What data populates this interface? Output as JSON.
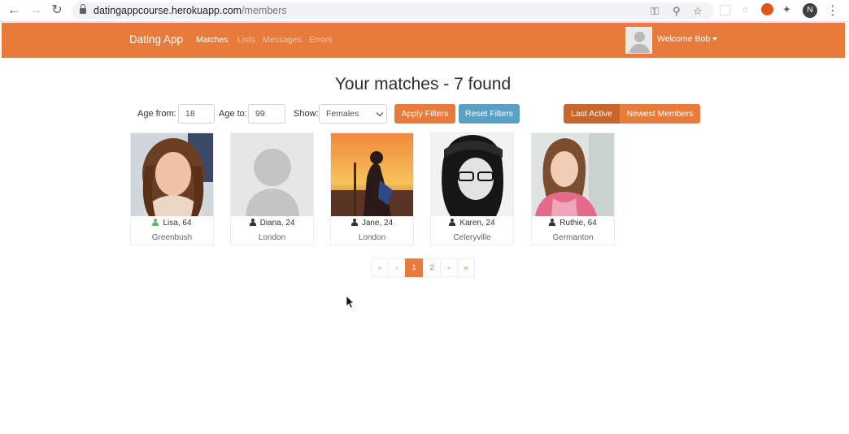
{
  "browser": {
    "url_host": "datingappcourse.herokuapp.com",
    "url_path": "/members",
    "profile_initial": "N"
  },
  "navbar": {
    "brand": "Dating App",
    "links": [
      "Matches",
      "Lists",
      "Messages",
      "Errors"
    ],
    "active_link": "Matches",
    "welcome": "Welcome Bob",
    "color": "#e77b3c"
  },
  "title": "Your matches - 7 found",
  "filters": {
    "age_from_label": "Age from:",
    "age_from_value": "18",
    "age_to_label": "Age to:",
    "age_to_value": "99",
    "show_label": "Show:",
    "show_value": "Females",
    "apply_label": "Apply Filters",
    "reset_label": "Reset Filters"
  },
  "sort": {
    "last_active": "Last Active",
    "newest": "Newest Members",
    "selected": "Last Active"
  },
  "members": [
    {
      "name": "Lisa, 64",
      "city": "Greenbush",
      "online": true
    },
    {
      "name": "Diana, 24",
      "city": "London",
      "online": false
    },
    {
      "name": "Jane, 24",
      "city": "London",
      "online": false
    },
    {
      "name": "Karen, 24",
      "city": "Celeryville",
      "online": false
    },
    {
      "name": "Ruthie, 64",
      "city": "Germanton",
      "online": false
    }
  ],
  "pagination": {
    "first": "«",
    "prev": "‹",
    "pages": [
      "1",
      "2"
    ],
    "current": "1",
    "next": "›",
    "last": "»"
  },
  "colors": {
    "accent": "#e77b3c",
    "reset_button": "#5a9fc4",
    "online_icon": "#6bb36b"
  }
}
